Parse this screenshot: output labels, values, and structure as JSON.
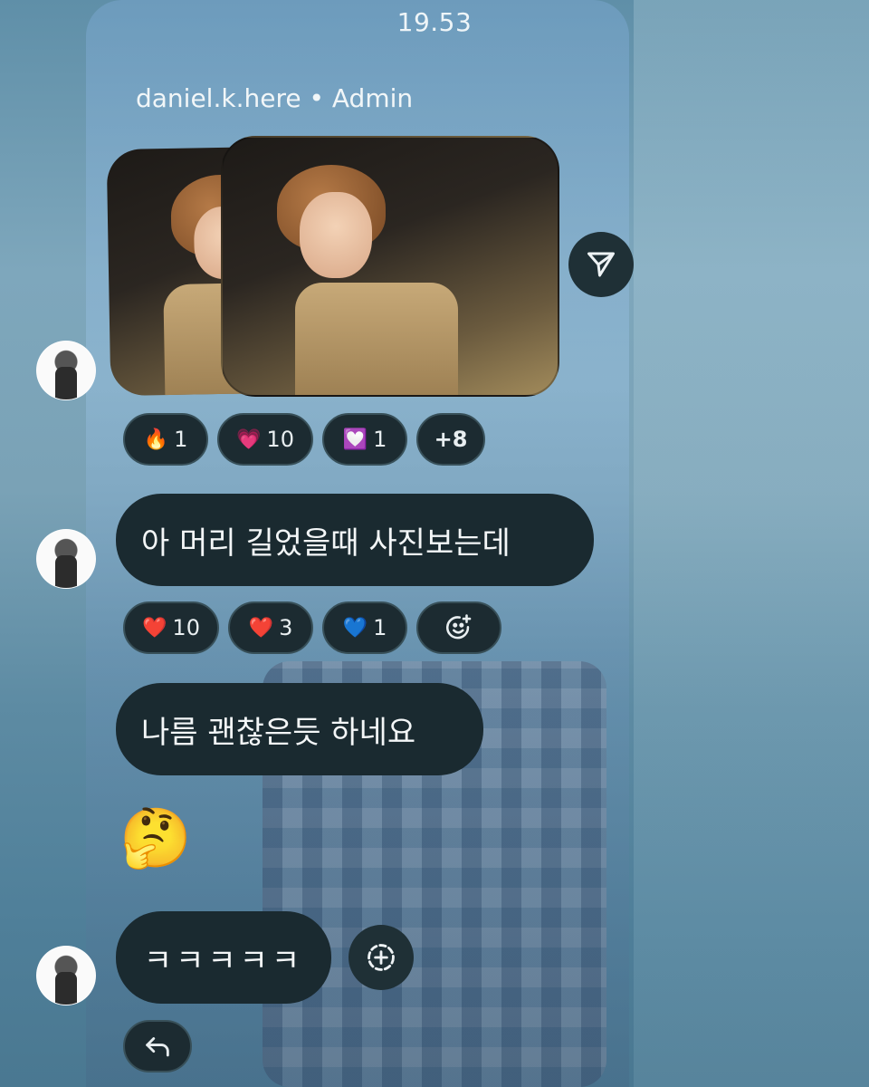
{
  "status_bar": {
    "time": "19.53"
  },
  "header": {
    "sender_name": "daniel.k.here • Admin"
  },
  "message_1": {
    "type": "photo_stack",
    "reactions": [
      {
        "emoji": "🔥",
        "count": "1"
      },
      {
        "emoji": "💗",
        "count": "10"
      },
      {
        "emoji": "💟",
        "count": "1"
      },
      {
        "emoji": "",
        "count": "+8"
      }
    ]
  },
  "message_2": {
    "text": "아 머리 길었을때 사진보는데",
    "reactions": [
      {
        "emoji": "❤️",
        "count": "10"
      },
      {
        "emoji": "❤️",
        "count": "3"
      },
      {
        "emoji": "💙",
        "count": "1"
      }
    ]
  },
  "message_3": {
    "text": "나름 괜찮은듯 하네요"
  },
  "message_4": {
    "emoji": "🤔"
  },
  "message_5": {
    "text": "ㅋㅋㅋㅋㅋ"
  },
  "colors": {
    "bubble": "#1a2a30",
    "pill_border": "#385059",
    "text": "#f3f6f7"
  }
}
